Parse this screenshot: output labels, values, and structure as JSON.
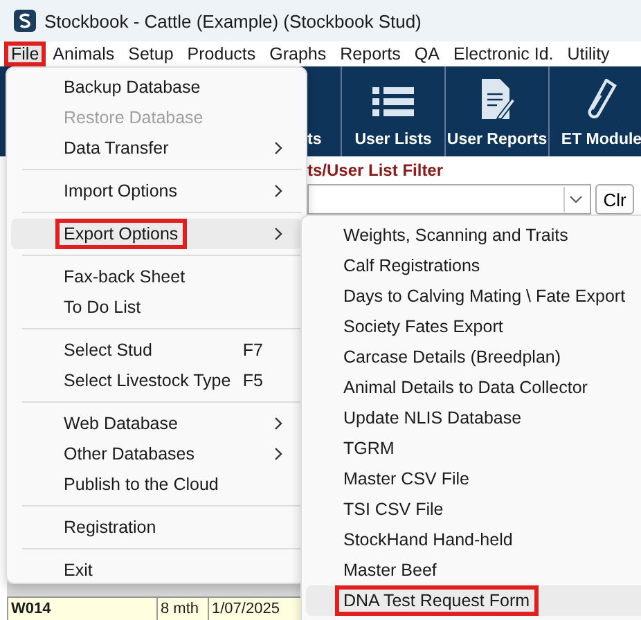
{
  "window": {
    "title": "Stockbook - Cattle (Example) (Stockbook Stud)"
  },
  "menu_bar": [
    {
      "label": "File",
      "selected": true,
      "highlighted": true
    },
    {
      "label": "Animals",
      "selected": false,
      "highlighted": false
    },
    {
      "label": "Setup",
      "selected": false,
      "highlighted": false
    },
    {
      "label": "Products",
      "selected": false,
      "highlighted": false
    },
    {
      "label": "Graphs",
      "selected": false,
      "highlighted": false
    },
    {
      "label": "Reports",
      "selected": false,
      "highlighted": false
    },
    {
      "label": "QA",
      "selected": false,
      "highlighted": false
    },
    {
      "label": "Electronic Id.",
      "selected": false,
      "highlighted": false
    },
    {
      "label": "Utility",
      "selected": false,
      "highlighted": false
    }
  ],
  "toolbar": [
    {
      "label": "ts"
    },
    {
      "label": "User Lists",
      "kind": "list"
    },
    {
      "label": "User Reports",
      "kind": "report"
    },
    {
      "label": "ET Module",
      "kind": "tube"
    }
  ],
  "filter": {
    "label": "ts/User List Filter",
    "clear_button": "Clr"
  },
  "table": {
    "rows": [
      {
        "cells": [
          "W014",
          "8 mth",
          "1/07/2025"
        ]
      }
    ]
  },
  "file_menu": {
    "items": [
      {
        "kind": "item",
        "label": "Backup Database",
        "disabled": false,
        "submenu": false,
        "selected": false,
        "highlighted": false
      },
      {
        "kind": "item",
        "label": "Restore Database",
        "disabled": true,
        "submenu": false,
        "selected": false,
        "highlighted": false
      },
      {
        "kind": "item",
        "label": "Data Transfer",
        "disabled": false,
        "submenu": true,
        "selected": false,
        "highlighted": false
      },
      {
        "kind": "separator"
      },
      {
        "kind": "item",
        "label": "Import Options",
        "disabled": false,
        "submenu": true,
        "selected": false,
        "highlighted": false
      },
      {
        "kind": "separator"
      },
      {
        "kind": "item",
        "label": "Export Options",
        "disabled": false,
        "submenu": true,
        "selected": true,
        "highlighted": true
      },
      {
        "kind": "separator"
      },
      {
        "kind": "item",
        "label": "Fax-back Sheet",
        "disabled": false,
        "submenu": false,
        "selected": false,
        "highlighted": false
      },
      {
        "kind": "item",
        "label": "To Do List",
        "disabled": false,
        "submenu": false,
        "selected": false,
        "highlighted": false
      },
      {
        "kind": "separator"
      },
      {
        "kind": "item",
        "label": "Select Stud",
        "shortcut": "F7",
        "disabled": false,
        "submenu": false,
        "selected": false,
        "highlighted": false
      },
      {
        "kind": "item",
        "label": "Select Livestock Type",
        "shortcut": "F5",
        "disabled": false,
        "submenu": false,
        "selected": false,
        "highlighted": false
      },
      {
        "kind": "separator"
      },
      {
        "kind": "item",
        "label": "Web Database",
        "disabled": false,
        "submenu": true,
        "selected": false,
        "highlighted": false
      },
      {
        "kind": "item",
        "label": "Other Databases",
        "disabled": false,
        "submenu": true,
        "selected": false,
        "highlighted": false
      },
      {
        "kind": "item",
        "label": "Publish to the Cloud",
        "disabled": false,
        "submenu": false,
        "selected": false,
        "highlighted": false
      },
      {
        "kind": "separator"
      },
      {
        "kind": "item",
        "label": "Registration",
        "disabled": false,
        "submenu": false,
        "selected": false,
        "highlighted": false
      },
      {
        "kind": "separator"
      },
      {
        "kind": "item",
        "label": "Exit",
        "disabled": false,
        "submenu": false,
        "selected": false,
        "highlighted": false
      }
    ]
  },
  "export_submenu": {
    "items": [
      {
        "label": "Weights, Scanning and Traits",
        "selected": false,
        "highlighted": false
      },
      {
        "label": "Calf Registrations",
        "selected": false,
        "highlighted": false
      },
      {
        "label": "Days to Calving Mating \\ Fate Export",
        "selected": false,
        "highlighted": false
      },
      {
        "label": "Society Fates Export",
        "selected": false,
        "highlighted": false
      },
      {
        "label": "Carcase Details (Breedplan)",
        "selected": false,
        "highlighted": false
      },
      {
        "label": "Animal Details to Data Collector",
        "selected": false,
        "highlighted": false
      },
      {
        "label": "Update NLIS Database",
        "selected": false,
        "highlighted": false
      },
      {
        "label": "TGRM",
        "selected": false,
        "highlighted": false
      },
      {
        "label": "Master CSV File",
        "selected": false,
        "highlighted": false
      },
      {
        "label": "TSI CSV File",
        "selected": false,
        "highlighted": false
      },
      {
        "label": "StockHand Hand-held",
        "selected": false,
        "highlighted": false
      },
      {
        "label": "Master Beef",
        "selected": false,
        "highlighted": false
      },
      {
        "label": "DNA Test Request Form",
        "selected": true,
        "highlighted": true
      }
    ]
  }
}
